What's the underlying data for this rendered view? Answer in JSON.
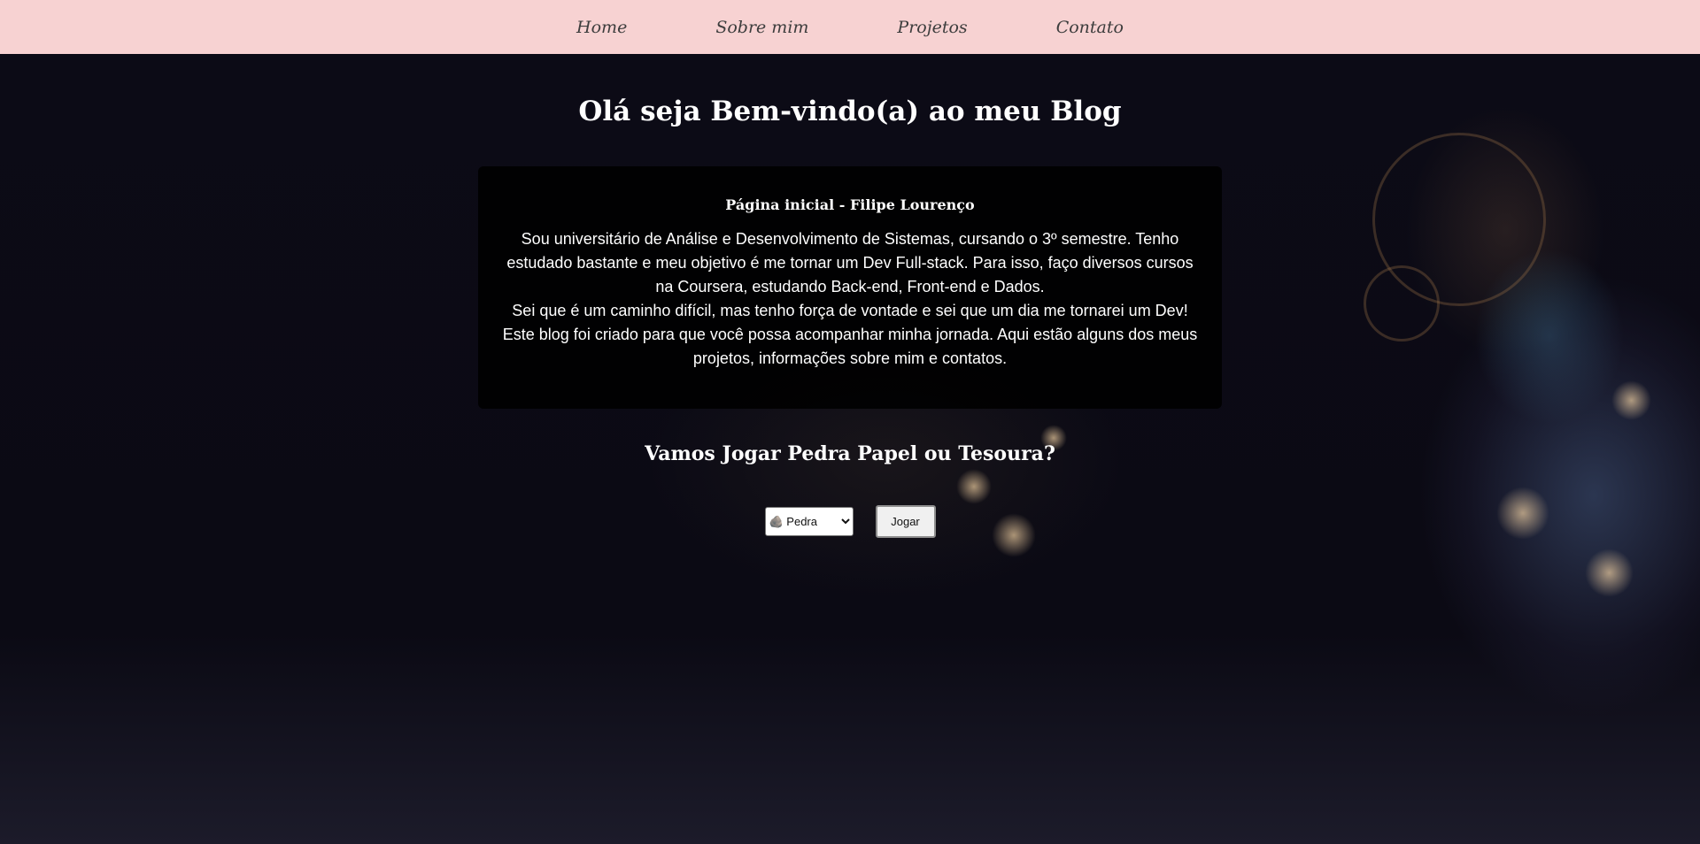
{
  "nav": {
    "items": [
      {
        "label": "Home"
      },
      {
        "label": "Sobre mim"
      },
      {
        "label": "Projetos"
      },
      {
        "label": "Contato"
      }
    ]
  },
  "main": {
    "title": "Olá seja Bem-vindo(a) ao meu Blog",
    "card": {
      "heading": "Página inicial - Filipe Lourenço",
      "paragraph_1": "Sou universitário de Análise e Desenvolvimento de Sistemas, cursando o 3º semestre. Tenho estudado bastante e meu objetivo é me tornar um Dev Full-stack. Para isso, faço diversos cursos na Coursera, estudando Back-end, Front-end e Dados.",
      "paragraph_2": "Sei que é um caminho difícil, mas tenho força de vontade e sei que um dia me tornarei um Dev! Este blog foi criado para que você possa acompanhar minha jornada. Aqui estão alguns dos meus projetos, informações sobre mim e contatos."
    }
  },
  "game": {
    "title": "Vamos Jogar Pedra Papel ou Tesoura?",
    "selected_option": "🪨 Pedra",
    "play_label": "Jogar"
  },
  "colors": {
    "navbar_bg": "#f7d2d2",
    "page_bg": "#0b0a14",
    "card_bg": "#000000",
    "text": "#ffffff"
  }
}
